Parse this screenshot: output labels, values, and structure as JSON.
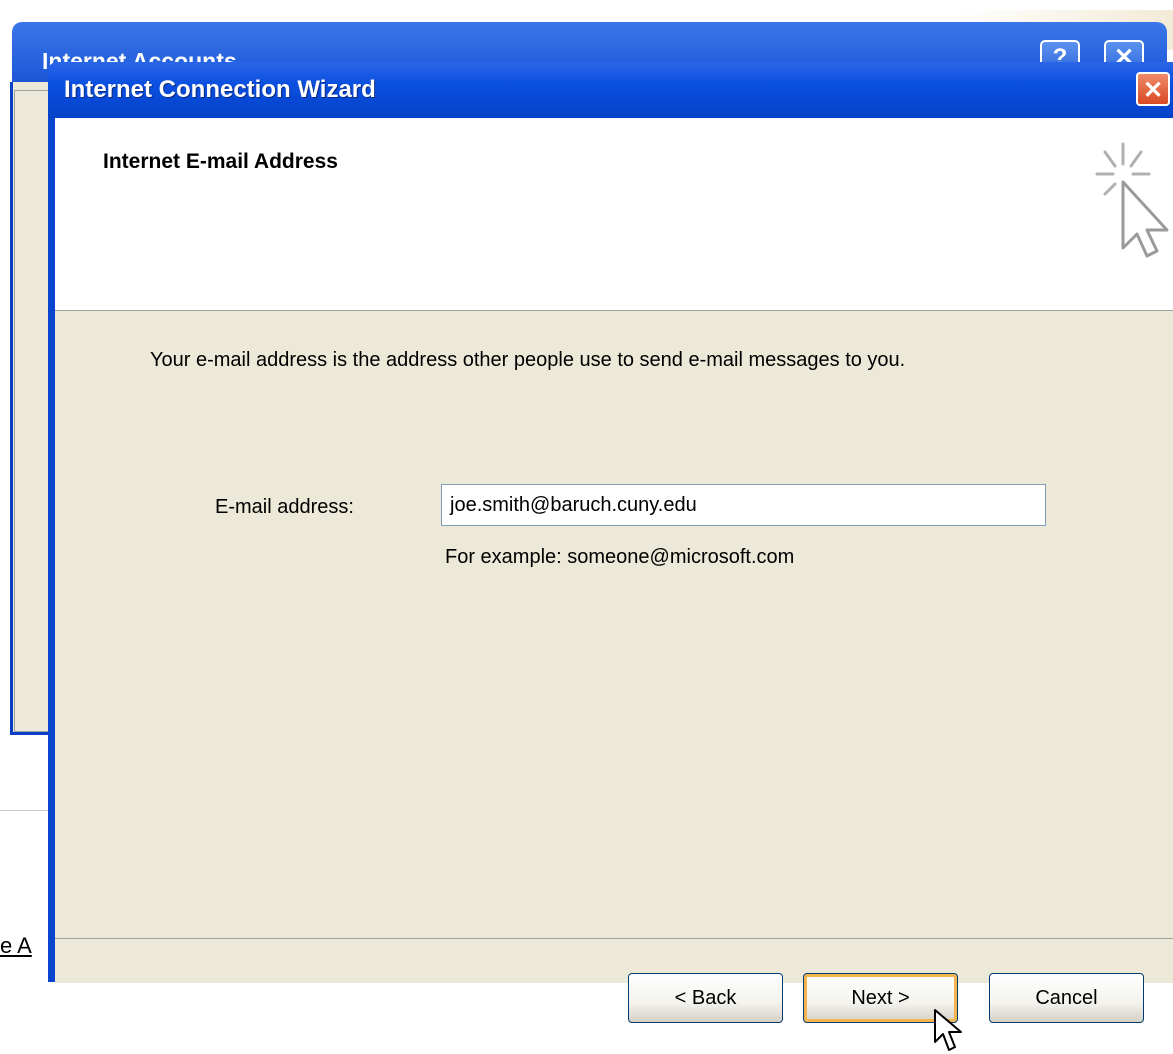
{
  "background_window": {
    "title": "Internet Accounts",
    "help_button": "?",
    "close_button": "✕",
    "link_fragment": "e A"
  },
  "wizard": {
    "title": "Internet Connection Wizard",
    "close_button": "✕",
    "header_title": "Internet E-mail Address",
    "header_icon": "wizard-wand-cursor-icon",
    "description": "Your e-mail address is the address other people use to send e-mail messages to you.",
    "email_label": "E-mail address:",
    "email_value": "joe.smith@baruch.cuny.edu",
    "example_text": "For example: someone@microsoft.com",
    "buttons": {
      "back": "< Back",
      "next": "Next >",
      "cancel": "Cancel"
    }
  },
  "colors": {
    "titlebar": "#0a4fe0",
    "dialog_body": "#ece9d8",
    "close_button": "#d84a22"
  }
}
